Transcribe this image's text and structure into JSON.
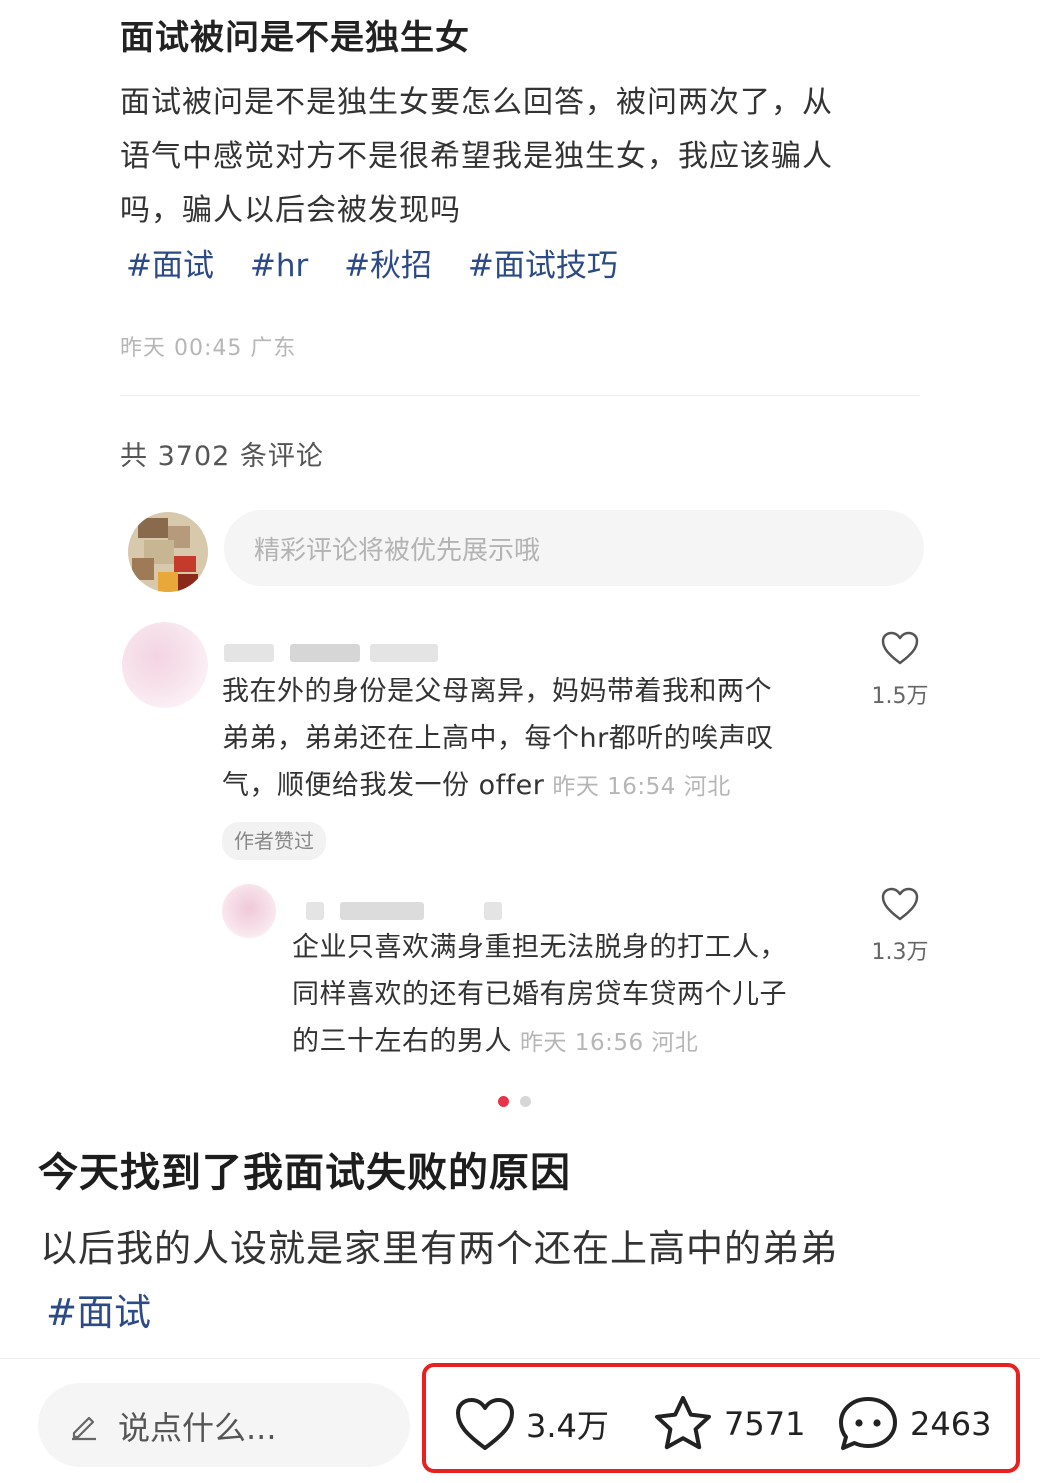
{
  "post": {
    "title": "面试被问是不是独生女",
    "body_lines": [
      "面试被问是不是独生女要怎么回答，被问两次了，从",
      "语气中感觉对方不是很希望我是独生女，我应该骗人",
      "吗，骗人以后会被发现吗"
    ],
    "tags": [
      "#面试",
      "#hr",
      "#秋招",
      "#面试技巧"
    ],
    "meta": "昨天 00:45 广东"
  },
  "comments_section": {
    "count_label": "共 3702 条评论",
    "input_placeholder": "精彩评论将被优先展示哦"
  },
  "comments": [
    {
      "text_lines": [
        "我在外的身份是父母离异，妈妈带着我和两个",
        "弟弟，弟弟还在上高中，每个hr都听的唉声叹",
        "气，顺便给我发一份 offer"
      ],
      "meta": "昨天 16:54 河北",
      "likes": "1.5万",
      "badge": "作者赞过"
    },
    {
      "text_lines": [
        "企业只喜欢满身重担无法脱身的打工人，",
        "同样喜欢的还有已婚有房贷车贷两个儿子",
        "的三十左右的男人"
      ],
      "meta": "昨天 16:56 河北",
      "likes": "1.3万"
    }
  ],
  "post2": {
    "title": "今天找到了我面试失败的原因",
    "body": "以后我的人设就是家里有两个还在上高中的弟弟",
    "tag": "#面试"
  },
  "bottom_bar": {
    "input_placeholder": "说点什么...",
    "likes": "3.4万",
    "favorites": "7571",
    "comments": "2463"
  },
  "colors": {
    "tag": "#2b4a86",
    "highlight_border": "#e8201f",
    "active_dot": "#e8324a"
  },
  "icons": [
    "heart-icon",
    "star-icon",
    "comment-bubble-icon",
    "pencil-icon"
  ]
}
